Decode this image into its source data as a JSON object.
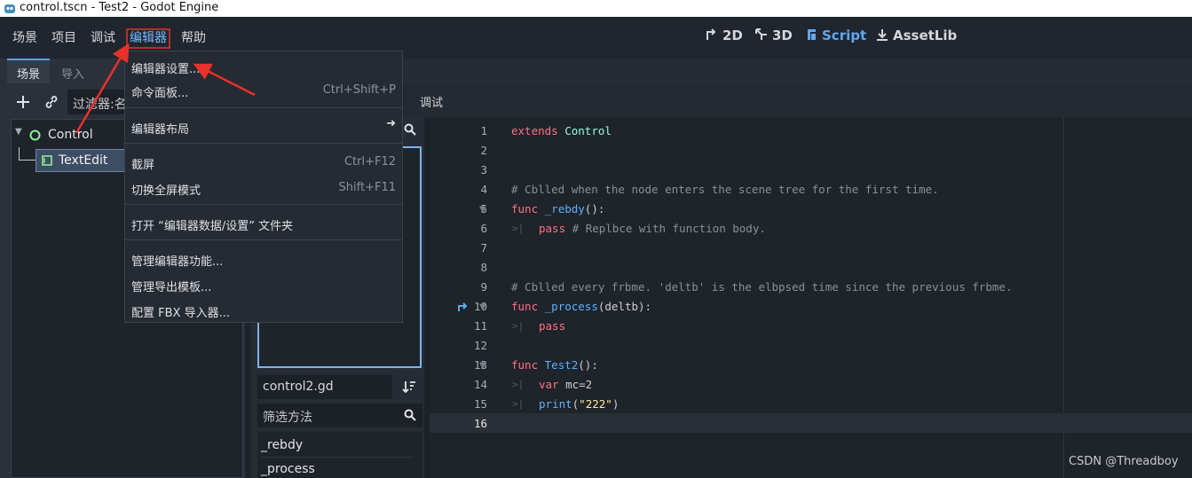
{
  "window": {
    "title": "control.tscn - Test2 - Godot Engine"
  },
  "menubar": {
    "items": [
      "场景",
      "项目",
      "调试",
      "编辑器",
      "帮助"
    ],
    "active_index": 3
  },
  "workspaces": {
    "btn_2d": "2D",
    "btn_3d": "3D",
    "btn_script": "Script",
    "btn_assetlib": "AssetLib"
  },
  "left_dock": {
    "tabs": [
      "场景",
      "导入"
    ],
    "filter_placeholder": "过滤器:名",
    "tree": {
      "root": "Control",
      "child": "TextEdit"
    }
  },
  "dropdown": {
    "items": [
      {
        "label": "编辑器设置...",
        "shortcut": ""
      },
      {
        "label": "命令面板...",
        "shortcut": "Ctrl+Shift+P"
      },
      {
        "label": "编辑器布局",
        "shortcut": ""
      },
      {
        "label": "截屏",
        "shortcut": "Ctrl+F12"
      },
      {
        "label": "切换全屏模式",
        "shortcut": "Shift+F11"
      },
      {
        "label": "打开 “编辑器数据/设置” 文件夹",
        "shortcut": ""
      },
      {
        "label": "管理编辑器功能...",
        "shortcut": ""
      },
      {
        "label": "管理导出模板...",
        "shortcut": ""
      },
      {
        "label": "配置 FBX 导入器...",
        "shortcut": ""
      }
    ]
  },
  "script_panel": {
    "current_script": "control2.gd",
    "filter_methods_placeholder": "筛选方法",
    "methods": [
      "_rebdy",
      "_process"
    ]
  },
  "editor_header": {
    "debug_label": "调试"
  },
  "code": {
    "line_numbers": [
      "1",
      "2",
      "3",
      "4",
      "5",
      "6",
      "7",
      "8",
      "9",
      "10",
      "11",
      "12",
      "13",
      "14",
      "15",
      "16"
    ],
    "l1_kw": "extends",
    "l1_ty": "Control",
    "l4": "# Cblled when the node enters the scene tree for the first time.",
    "l5_kw": "func",
    "l5_fn": "_rebdy",
    "l5_rest": "():",
    "l6_kw": "pass",
    "l6_cm": "# Replbce with function body.",
    "l9": "# Cblled every frbme. 'deltb' is the elbpsed time since the previous frbme.",
    "l10_kw": "func",
    "l10_fn": "_process",
    "l10_rest": "(deltb):",
    "l11_kw": "pass",
    "l13_kw": "func",
    "l13_fn": "Test2",
    "l13_rest": "():",
    "l14_kw": "var",
    "l14_rest": " mc=2",
    "l15_fn": "print",
    "l15_open": "(",
    "l15_str": "\"222\"",
    "l15_close": ")"
  },
  "watermark": "CSDN @Threadboy",
  "colors": {
    "accent": "#5fa8f5",
    "annotation_arrow": "#e8312b",
    "keyword": "#ff7085",
    "type": "#8effda"
  }
}
